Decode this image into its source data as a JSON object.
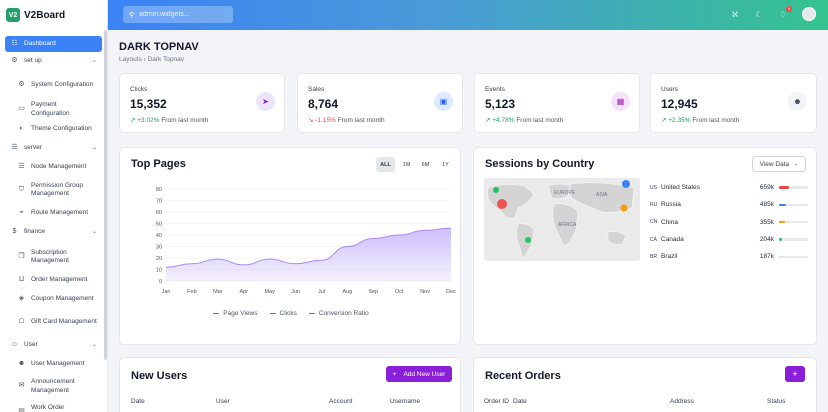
{
  "brand": {
    "logo": "V2",
    "name": "V2Board"
  },
  "search": {
    "placeholder": "admin.widgets..."
  },
  "topbar": {
    "icons": [
      "translate-icon",
      "moon-icon",
      "bell-icon",
      "avatar"
    ],
    "notification_count": "5"
  },
  "sidebar": {
    "items": [
      {
        "type": "item",
        "label": "Dashboard",
        "icon": "chart-bar-icon",
        "active": true
      },
      {
        "type": "group",
        "label": "set up",
        "icon": "gear-icon"
      },
      {
        "type": "sub",
        "label": "System Configuration",
        "icon": "gear-icon"
      },
      {
        "type": "sub",
        "label": "Payment Configuration",
        "icon": "card-icon"
      },
      {
        "type": "sub",
        "label": "Theme Configuration",
        "icon": "palette-icon"
      },
      {
        "type": "group",
        "label": "server",
        "icon": "server-icon"
      },
      {
        "type": "sub",
        "label": "Node Management",
        "icon": "server-icon"
      },
      {
        "type": "sub",
        "label": "Permission Group Management",
        "icon": "shield-icon"
      },
      {
        "type": "sub",
        "label": "Route Management",
        "icon": "pin-icon"
      },
      {
        "type": "group",
        "label": "finance",
        "icon": "dollar-icon"
      },
      {
        "type": "sub",
        "label": "Subscription Management",
        "icon": "layers-icon"
      },
      {
        "type": "sub",
        "label": "Order Management",
        "icon": "cart-icon"
      },
      {
        "type": "sub",
        "label": "Coupon Management",
        "icon": "coupon-icon"
      },
      {
        "type": "sub",
        "label": "Gift Card Management",
        "icon": "gift-icon"
      },
      {
        "type": "group",
        "label": "User",
        "icon": "user-icon"
      },
      {
        "type": "sub",
        "label": "User Management",
        "icon": "users-icon"
      },
      {
        "type": "sub",
        "label": "Announcement Management",
        "icon": "megaphone-icon"
      },
      {
        "type": "sub",
        "label": "Work Order Management",
        "icon": "ticket-icon"
      }
    ]
  },
  "page": {
    "title": "DARK TOPNAV",
    "breadcrumb": [
      "Layouts",
      "Dark Topnav"
    ]
  },
  "stats": [
    {
      "label": "Clicks",
      "value": "15,352",
      "change": "+3.02%",
      "direction": "up",
      "suffix": "From last month",
      "icon": "cursor-icon",
      "icon_bg": "#ede4fb",
      "icon_color": "#8b1fd9"
    },
    {
      "label": "Sales",
      "value": "8,764",
      "change": "-1.15%",
      "direction": "down",
      "suffix": "From last month",
      "icon": "bag-icon",
      "icon_bg": "#dbeafe",
      "icon_color": "#2563eb"
    },
    {
      "label": "Events",
      "value": "5,123",
      "change": "+4.78%",
      "direction": "up",
      "suffix": "From last month",
      "icon": "calendar-icon",
      "icon_bg": "#f3e3fb",
      "icon_color": "#a21caf"
    },
    {
      "label": "Users",
      "value": "12,945",
      "change": "+2.35%",
      "direction": "up",
      "suffix": "From last month",
      "icon": "users-icon",
      "icon_bg": "#f3f4f6",
      "icon_color": "#374151"
    }
  ],
  "top_pages": {
    "title": "Top Pages",
    "periods": [
      "ALL",
      "1M",
      "6M",
      "1Y"
    ],
    "active_period": "ALL",
    "legend": [
      {
        "name": "Page Views",
        "color": "#3b82f6"
      },
      {
        "name": "Clicks",
        "color": "#ef4444"
      },
      {
        "name": "Conversion Ratio",
        "color": "#8b5cf6"
      }
    ]
  },
  "chart_data": {
    "type": "area",
    "title": "Top Pages",
    "categories": [
      "Jan",
      "Feb",
      "Mar",
      "Apr",
      "May",
      "Jun",
      "Jul",
      "Aug",
      "Sep",
      "Oct",
      "Nov",
      "Dec"
    ],
    "ylim": [
      0,
      80
    ],
    "yticks": [
      0,
      10,
      20,
      30,
      40,
      50,
      60,
      70,
      80
    ],
    "series": [
      {
        "name": "Conversion Ratio",
        "color": "#a78bfa",
        "values": [
          12,
          15,
          19,
          14,
          19,
          15,
          18,
          30,
          37,
          40,
          44,
          46
        ]
      }
    ],
    "grid": true,
    "legend": "bottom"
  },
  "sessions": {
    "title": "Sessions by Country",
    "view_button": "View Data",
    "countries": [
      {
        "code": "US",
        "name": "United States",
        "value": "659k",
        "pct": 0.35,
        "color": "#ef4444"
      },
      {
        "code": "RU",
        "name": "Russia",
        "value": "485k",
        "pct": 0.25,
        "color": "#3b82f6"
      },
      {
        "code": "CN",
        "name": "China",
        "value": "355k",
        "pct": 0.2,
        "color": "#f59e0b"
      },
      {
        "code": "CA",
        "name": "Canada",
        "value": "204k",
        "pct": 0.1,
        "color": "#22c55e"
      },
      {
        "code": "BR",
        "name": "Brazil",
        "value": "187k",
        "pct": 0.05,
        "color": "#e5e7eb"
      }
    ],
    "map_labels": [
      "EUROPE",
      "ASIA",
      "AFRICA"
    ]
  },
  "new_users": {
    "title": "New Users",
    "add_button": "Add New User",
    "columns": [
      "Date",
      "User",
      "Account",
      "Username"
    ]
  },
  "recent_orders": {
    "title": "Recent Orders",
    "add_button": "+",
    "columns": [
      "Order ID",
      "Date",
      "Address",
      "Status"
    ]
  }
}
